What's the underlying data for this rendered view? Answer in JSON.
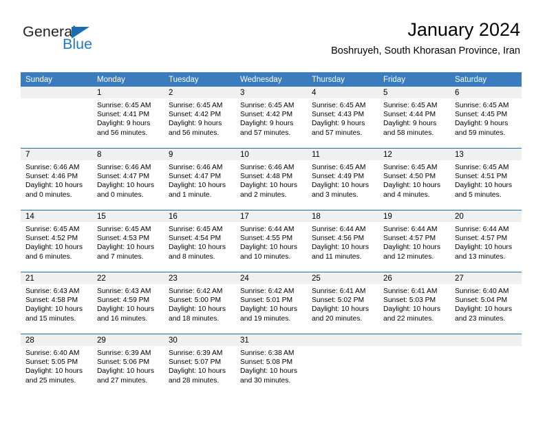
{
  "brand": {
    "name_part1": "General",
    "name_part2": "Blue",
    "logo_icon": "triangle-logo-icon"
  },
  "header": {
    "title": "January 2024",
    "subtitle": "Boshruyeh, South Khorasan Province, Iran"
  },
  "colors": {
    "header_blue": "#3a7cbe",
    "separator_blue": "#1b6cb0",
    "daynum_band": "#f0f0f0",
    "brand_blue": "#2277c8"
  },
  "calendar": {
    "weekday_headers": [
      "Sunday",
      "Monday",
      "Tuesday",
      "Wednesday",
      "Thursday",
      "Friday",
      "Saturday"
    ],
    "weeks": [
      [
        {
          "day": "",
          "lines": []
        },
        {
          "day": "1",
          "lines": [
            "Sunrise: 6:45 AM",
            "Sunset: 4:41 PM",
            "Daylight: 9 hours and 56 minutes."
          ]
        },
        {
          "day": "2",
          "lines": [
            "Sunrise: 6:45 AM",
            "Sunset: 4:42 PM",
            "Daylight: 9 hours and 56 minutes."
          ]
        },
        {
          "day": "3",
          "lines": [
            "Sunrise: 6:45 AM",
            "Sunset: 4:42 PM",
            "Daylight: 9 hours and 57 minutes."
          ]
        },
        {
          "day": "4",
          "lines": [
            "Sunrise: 6:45 AM",
            "Sunset: 4:43 PM",
            "Daylight: 9 hours and 57 minutes."
          ]
        },
        {
          "day": "5",
          "lines": [
            "Sunrise: 6:45 AM",
            "Sunset: 4:44 PM",
            "Daylight: 9 hours and 58 minutes."
          ]
        },
        {
          "day": "6",
          "lines": [
            "Sunrise: 6:45 AM",
            "Sunset: 4:45 PM",
            "Daylight: 9 hours and 59 minutes."
          ]
        }
      ],
      [
        {
          "day": "7",
          "lines": [
            "Sunrise: 6:46 AM",
            "Sunset: 4:46 PM",
            "Daylight: 10 hours and 0 minutes."
          ]
        },
        {
          "day": "8",
          "lines": [
            "Sunrise: 6:46 AM",
            "Sunset: 4:47 PM",
            "Daylight: 10 hours and 0 minutes."
          ]
        },
        {
          "day": "9",
          "lines": [
            "Sunrise: 6:46 AM",
            "Sunset: 4:47 PM",
            "Daylight: 10 hours and 1 minute."
          ]
        },
        {
          "day": "10",
          "lines": [
            "Sunrise: 6:46 AM",
            "Sunset: 4:48 PM",
            "Daylight: 10 hours and 2 minutes."
          ]
        },
        {
          "day": "11",
          "lines": [
            "Sunrise: 6:45 AM",
            "Sunset: 4:49 PM",
            "Daylight: 10 hours and 3 minutes."
          ]
        },
        {
          "day": "12",
          "lines": [
            "Sunrise: 6:45 AM",
            "Sunset: 4:50 PM",
            "Daylight: 10 hours and 4 minutes."
          ]
        },
        {
          "day": "13",
          "lines": [
            "Sunrise: 6:45 AM",
            "Sunset: 4:51 PM",
            "Daylight: 10 hours and 5 minutes."
          ]
        }
      ],
      [
        {
          "day": "14",
          "lines": [
            "Sunrise: 6:45 AM",
            "Sunset: 4:52 PM",
            "Daylight: 10 hours and 6 minutes."
          ]
        },
        {
          "day": "15",
          "lines": [
            "Sunrise: 6:45 AM",
            "Sunset: 4:53 PM",
            "Daylight: 10 hours and 7 minutes."
          ]
        },
        {
          "day": "16",
          "lines": [
            "Sunrise: 6:45 AM",
            "Sunset: 4:54 PM",
            "Daylight: 10 hours and 8 minutes."
          ]
        },
        {
          "day": "17",
          "lines": [
            "Sunrise: 6:44 AM",
            "Sunset: 4:55 PM",
            "Daylight: 10 hours and 10 minutes."
          ]
        },
        {
          "day": "18",
          "lines": [
            "Sunrise: 6:44 AM",
            "Sunset: 4:56 PM",
            "Daylight: 10 hours and 11 minutes."
          ]
        },
        {
          "day": "19",
          "lines": [
            "Sunrise: 6:44 AM",
            "Sunset: 4:57 PM",
            "Daylight: 10 hours and 12 minutes."
          ]
        },
        {
          "day": "20",
          "lines": [
            "Sunrise: 6:44 AM",
            "Sunset: 4:57 PM",
            "Daylight: 10 hours and 13 minutes."
          ]
        }
      ],
      [
        {
          "day": "21",
          "lines": [
            "Sunrise: 6:43 AM",
            "Sunset: 4:58 PM",
            "Daylight: 10 hours and 15 minutes."
          ]
        },
        {
          "day": "22",
          "lines": [
            "Sunrise: 6:43 AM",
            "Sunset: 4:59 PM",
            "Daylight: 10 hours and 16 minutes."
          ]
        },
        {
          "day": "23",
          "lines": [
            "Sunrise: 6:42 AM",
            "Sunset: 5:00 PM",
            "Daylight: 10 hours and 18 minutes."
          ]
        },
        {
          "day": "24",
          "lines": [
            "Sunrise: 6:42 AM",
            "Sunset: 5:01 PM",
            "Daylight: 10 hours and 19 minutes."
          ]
        },
        {
          "day": "25",
          "lines": [
            "Sunrise: 6:41 AM",
            "Sunset: 5:02 PM",
            "Daylight: 10 hours and 20 minutes."
          ]
        },
        {
          "day": "26",
          "lines": [
            "Sunrise: 6:41 AM",
            "Sunset: 5:03 PM",
            "Daylight: 10 hours and 22 minutes."
          ]
        },
        {
          "day": "27",
          "lines": [
            "Sunrise: 6:40 AM",
            "Sunset: 5:04 PM",
            "Daylight: 10 hours and 23 minutes."
          ]
        }
      ],
      [
        {
          "day": "28",
          "lines": [
            "Sunrise: 6:40 AM",
            "Sunset: 5:05 PM",
            "Daylight: 10 hours and 25 minutes."
          ]
        },
        {
          "day": "29",
          "lines": [
            "Sunrise: 6:39 AM",
            "Sunset: 5:06 PM",
            "Daylight: 10 hours and 27 minutes."
          ]
        },
        {
          "day": "30",
          "lines": [
            "Sunrise: 6:39 AM",
            "Sunset: 5:07 PM",
            "Daylight: 10 hours and 28 minutes."
          ]
        },
        {
          "day": "31",
          "lines": [
            "Sunrise: 6:38 AM",
            "Sunset: 5:08 PM",
            "Daylight: 10 hours and 30 minutes."
          ]
        },
        {
          "day": "",
          "lines": []
        },
        {
          "day": "",
          "lines": []
        },
        {
          "day": "",
          "lines": []
        }
      ]
    ]
  }
}
